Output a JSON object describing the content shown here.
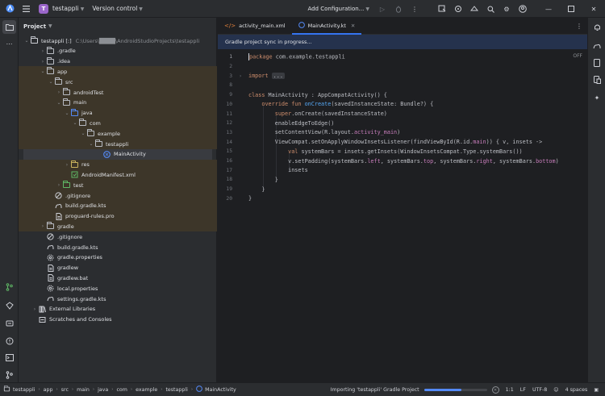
{
  "titlebar": {
    "project_badge": "T",
    "project_name": "testappli",
    "version_control": "Version control",
    "run_config": "Add Configuration..."
  },
  "project_panel": {
    "title": "Project",
    "root_name": "testappli [:]",
    "root_path": "C:\\Users\\████\\AndroidStudioProjects\\testappli",
    "items": [
      {
        "label": ".gradle",
        "depth": 1,
        "arrow": "›",
        "icon": "folder"
      },
      {
        "label": ".idea",
        "depth": 1,
        "arrow": "›",
        "icon": "folder"
      },
      {
        "label": "app",
        "depth": 1,
        "arrow": "⌄",
        "icon": "folder"
      },
      {
        "label": "src",
        "depth": 2,
        "arrow": "⌄",
        "icon": "folder"
      },
      {
        "label": "androidTest",
        "depth": 3,
        "arrow": "›",
        "icon": "folder"
      },
      {
        "label": "main",
        "depth": 3,
        "arrow": "⌄",
        "icon": "folder"
      },
      {
        "label": "java",
        "depth": 4,
        "arrow": "⌄",
        "icon": "folder-blue"
      },
      {
        "label": "com",
        "depth": 5,
        "arrow": "⌄",
        "icon": "folder"
      },
      {
        "label": "example",
        "depth": 6,
        "arrow": "⌄",
        "icon": "folder"
      },
      {
        "label": "testappli",
        "depth": 7,
        "arrow": "⌄",
        "icon": "folder"
      },
      {
        "label": "MainActivity",
        "depth": 8,
        "arrow": "",
        "icon": "kotlin"
      },
      {
        "label": "res",
        "depth": 4,
        "arrow": "›",
        "icon": "folder-res"
      },
      {
        "label": "AndroidManifest.xml",
        "depth": 4,
        "arrow": "",
        "icon": "manifest"
      },
      {
        "label": "test",
        "depth": 3,
        "arrow": "›",
        "icon": "folder-test"
      },
      {
        "label": ".gitignore",
        "depth": 2,
        "arrow": "",
        "icon": "gitignore"
      },
      {
        "label": "build.gradle.kts",
        "depth": 2,
        "arrow": "",
        "icon": "gradle"
      },
      {
        "label": "proguard-rules.pro",
        "depth": 2,
        "arrow": "",
        "icon": "file"
      },
      {
        "label": "gradle",
        "depth": 1,
        "arrow": "›",
        "icon": "folder"
      },
      {
        "label": ".gitignore",
        "depth": 1,
        "arrow": "",
        "icon": "gitignore"
      },
      {
        "label": "build.gradle.kts",
        "depth": 1,
        "arrow": "",
        "icon": "gradle"
      },
      {
        "label": "gradle.properties",
        "depth": 1,
        "arrow": "",
        "icon": "settings"
      },
      {
        "label": "gradlew",
        "depth": 1,
        "arrow": "",
        "icon": "file"
      },
      {
        "label": "gradlew.bat",
        "depth": 1,
        "arrow": "",
        "icon": "file"
      },
      {
        "label": "local.properties",
        "depth": 1,
        "arrow": "",
        "icon": "settings"
      },
      {
        "label": "settings.gradle.kts",
        "depth": 1,
        "arrow": "",
        "icon": "gradle"
      },
      {
        "label": "External Libraries",
        "depth": 0,
        "arrow": "›",
        "icon": "libraries"
      },
      {
        "label": "Scratches and Consoles",
        "depth": 0,
        "arrow": "",
        "icon": "scratches"
      }
    ]
  },
  "editor": {
    "tabs": [
      {
        "label": "activity_main.xml",
        "icon": "xml",
        "active": false
      },
      {
        "label": "MainActivity.kt",
        "icon": "kotlin",
        "active": true
      }
    ],
    "banner": "Gradle project sync in progress...",
    "badge": "OFF",
    "lines": [
      {
        "n": "1",
        "html": "<span class=\"caret\"></span><span class=\"kw\">package</span> com.example.testappli"
      },
      {
        "n": "2",
        "html": ""
      },
      {
        "n": "3",
        "fold": "›",
        "html": "<span class=\"kw\">import</span> <span class=\"folded\">...</span>"
      },
      {
        "n": "8",
        "html": ""
      },
      {
        "n": "9",
        "html": "<span class=\"kw\">class</span> MainActivity : AppCompatActivity() {"
      },
      {
        "n": "10",
        "html": "    <span class=\"kw\">override fun</span> <span class=\"fn\">onCreate</span>(savedInstanceState: Bundle?) {"
      },
      {
        "n": "11",
        "html": "        <span class=\"kw\">super</span>.onCreate(savedInstanceState)"
      },
      {
        "n": "12",
        "html": "        enableEdgeToEdge()"
      },
      {
        "n": "13",
        "html": "        setContentView(R.layout.<span class=\"prop\">activity_main</span>)"
      },
      {
        "n": "14",
        "html": "        ViewCompat.setOnApplyWindowInsetsListener(findViewById(R.id.<span class=\"prop\">main</span>)) { v, insets ->"
      },
      {
        "n": "15",
        "html": "            <span class=\"kw\">val</span> systemBars = insets.getInsets(WindowInsetsCompat.Type.systemBars())"
      },
      {
        "n": "16",
        "html": "            v.setPadding(systemBars.<span class=\"prop\">left</span>, systemBars.<span class=\"prop\">top</span>, systemBars.<span class=\"prop\">right</span>, systemBars.<span class=\"prop\">bottom</span>)"
      },
      {
        "n": "17",
        "html": "            insets"
      },
      {
        "n": "18",
        "html": "        }"
      },
      {
        "n": "19",
        "html": "    }"
      },
      {
        "n": "20",
        "html": "}"
      }
    ]
  },
  "statusbar": {
    "breadcrumbs": [
      "testappli",
      "app",
      "src",
      "main",
      "java",
      "com",
      "example",
      "testappli",
      "MainActivity"
    ],
    "task": "Importing 'testappli' Gradle Project",
    "position": "1:1",
    "line_sep": "LF",
    "encoding": "UTF-8",
    "indent": "4 spaces"
  },
  "colors": {
    "accent": "#3574f0",
    "highlight_folder_bg": "#3d3629",
    "selected_bg": "#393b40"
  }
}
